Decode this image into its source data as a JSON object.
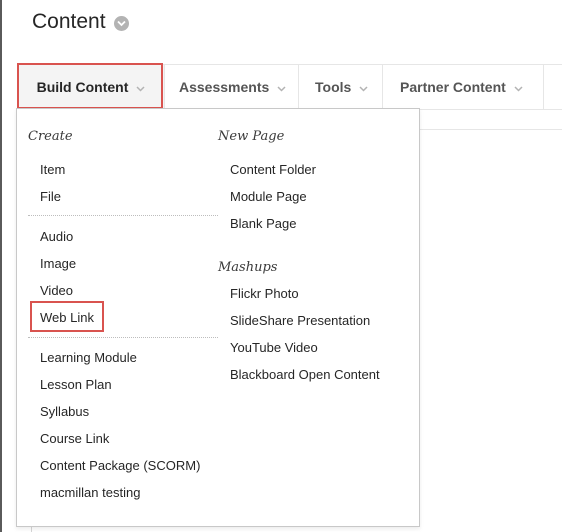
{
  "page": {
    "title": "Content"
  },
  "menubar": {
    "tabs": [
      {
        "label": "Build Content"
      },
      {
        "label": "Assessments"
      },
      {
        "label": "Tools"
      },
      {
        "label": "Partner Content"
      }
    ]
  },
  "dropdown": {
    "create": {
      "heading": "Create",
      "group1": [
        "Item",
        "File"
      ],
      "group2": [
        "Audio",
        "Image",
        "Video",
        "Web Link"
      ],
      "group3": [
        "Learning Module",
        "Lesson Plan",
        "Syllabus",
        "Course Link",
        "Content Package (SCORM)",
        "macmillan testing"
      ]
    },
    "new_page": {
      "heading": "New Page",
      "items": [
        "Content Folder",
        "Module Page",
        "Blank Page"
      ]
    },
    "mashups": {
      "heading": "Mashups",
      "items": [
        "Flickr Photo",
        "SlideShare Presentation",
        "YouTube Video",
        "Blackboard Open Content"
      ]
    }
  },
  "colors": {
    "highlight": "#d9534f",
    "caret": "#b3b3b3"
  },
  "icons": {
    "title_chevron": "chevron-down-icon",
    "tab_caret": "caret-down-icon"
  }
}
